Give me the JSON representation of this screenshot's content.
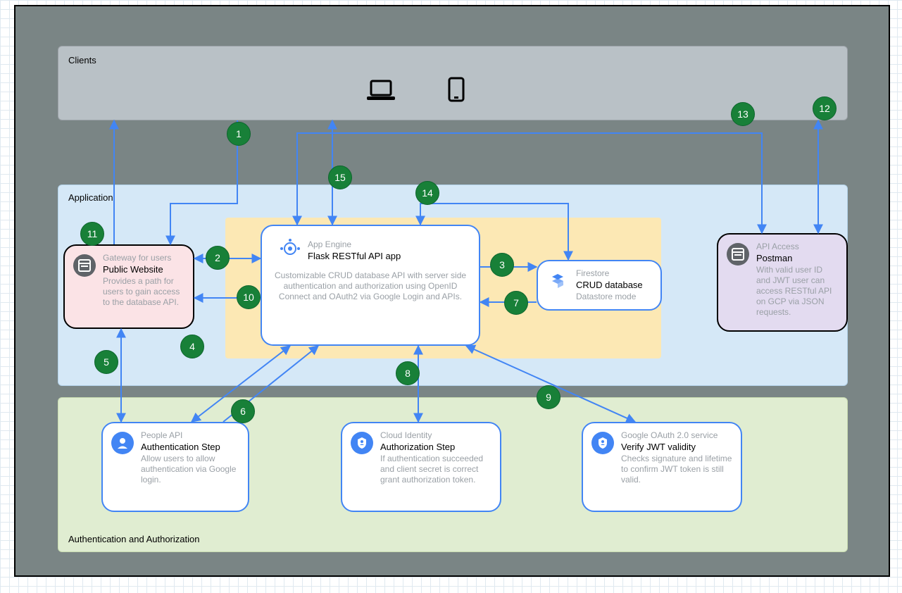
{
  "zones": {
    "clients": "Clients",
    "application": "Application",
    "auth": "Authentication and Authorization"
  },
  "nodes": {
    "public_website": {
      "subtitle": "Gateway for users",
      "title": "Public Website",
      "desc": "Provides a path for users to gain access to the database API."
    },
    "flask": {
      "subtitle": "App Engine",
      "title": "Flask RESTful API app",
      "desc": "Customizable CRUD database API with server side authentication and authorization using OpenID Connect and OAuth2 via Google Login and APIs."
    },
    "firestore": {
      "subtitle": "Firestore",
      "title": "CRUD database",
      "desc": "Datastore mode"
    },
    "api_access": {
      "subtitle": "API Access",
      "title": "Postman",
      "desc": "With valid user ID and JWT user can access RESTful API on GCP via JSON requests."
    },
    "auth_step": {
      "subtitle": "People API",
      "title": "Authentication Step",
      "desc": "Allow users to allow authentication via Google login."
    },
    "authz_step": {
      "subtitle": "Cloud Identity",
      "title": "Authorization Step",
      "desc": "If authentication succeeded and client secret is correct grant authorization token."
    },
    "verify": {
      "subtitle": "Google OAuth 2.0 service",
      "title": "Verify JWT validity",
      "desc": "Checks signature and lifetime to confirm JWT token is still valid."
    }
  },
  "markers": {
    "m1": "1",
    "m2": "2",
    "m3": "3",
    "m4": "4",
    "m5": "5",
    "m6": "6",
    "m7": "7",
    "m8": "8",
    "m9": "9",
    "m10": "10",
    "m11": "11",
    "m12": "12",
    "m13": "13",
    "m14": "14",
    "m15": "15"
  },
  "chart_data": {
    "type": "diagram",
    "title": "Architecture: Flask RESTful API with Google Auth on GCP",
    "zones": [
      {
        "id": "clients",
        "label": "Clients",
        "contains": [
          "laptop",
          "mobile"
        ]
      },
      {
        "id": "application",
        "label": "Application",
        "contains": [
          "public_website",
          "flask",
          "firestore",
          "api_access"
        ]
      },
      {
        "id": "auth",
        "label": "Authentication and Authorization",
        "contains": [
          "auth_step",
          "authz_step",
          "verify"
        ]
      }
    ],
    "nodes": [
      {
        "id": "public_website",
        "label": "Public Website",
        "service": "Gateway for users"
      },
      {
        "id": "flask",
        "label": "Flask RESTful API app",
        "service": "App Engine"
      },
      {
        "id": "firestore",
        "label": "CRUD database",
        "service": "Firestore (Datastore mode)"
      },
      {
        "id": "api_access",
        "label": "Postman",
        "service": "API Access"
      },
      {
        "id": "auth_step",
        "label": "Authentication Step",
        "service": "People API"
      },
      {
        "id": "authz_step",
        "label": "Authorization Step",
        "service": "Cloud Identity"
      },
      {
        "id": "verify",
        "label": "Verify JWT validity",
        "service": "Google OAuth 2.0 service"
      }
    ],
    "edges": [
      {
        "n": 1,
        "from": "clients",
        "to": "public_website",
        "bidirectional": false
      },
      {
        "n": 2,
        "from": "public_website",
        "to": "flask",
        "bidirectional": true
      },
      {
        "n": 3,
        "from": "flask",
        "to": "firestore",
        "bidirectional": false
      },
      {
        "n": 4,
        "from": "flask",
        "to": "auth_step",
        "bidirectional": true
      },
      {
        "n": 5,
        "from": "auth_step",
        "to": "public_website",
        "bidirectional": true
      },
      {
        "n": 6,
        "from": "auth_step",
        "to": "flask",
        "bidirectional": false
      },
      {
        "n": 7,
        "from": "firestore",
        "to": "flask",
        "bidirectional": false
      },
      {
        "n": 8,
        "from": "flask",
        "to": "authz_step",
        "bidirectional": true
      },
      {
        "n": 9,
        "from": "flask",
        "to": "verify",
        "bidirectional": true
      },
      {
        "n": 10,
        "from": "flask",
        "to": "public_website",
        "bidirectional": false
      },
      {
        "n": 11,
        "from": "public_website",
        "to": "clients",
        "bidirectional": false
      },
      {
        "n": 12,
        "from": "clients",
        "to": "api_access",
        "bidirectional": true
      },
      {
        "n": 13,
        "from": "api_access",
        "to": "flask",
        "bidirectional": true,
        "via": "clients"
      },
      {
        "n": 14,
        "from": "flask",
        "to": "firestore",
        "bidirectional": true
      },
      {
        "n": 15,
        "from": "flask",
        "to": "clients",
        "bidirectional": true
      }
    ]
  }
}
